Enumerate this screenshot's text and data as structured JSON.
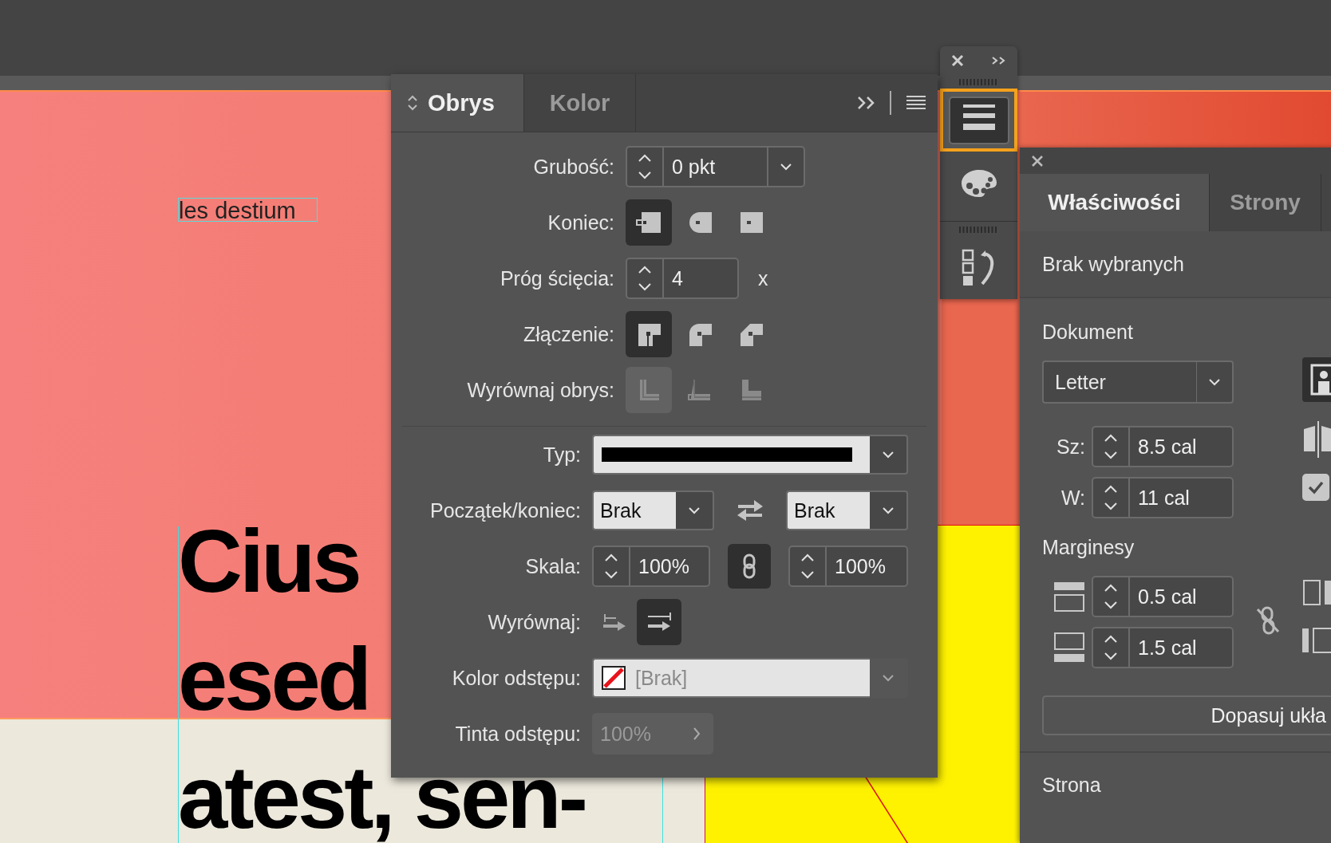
{
  "canvas": {
    "label_text": "les destium",
    "headline_lines": [
      "Cius",
      "esed",
      "atest, sen-"
    ]
  },
  "toolbar": {
    "buttons": [
      {
        "selected": true
      },
      {
        "selected": false
      },
      {
        "selected": false
      }
    ]
  },
  "stroke_panel": {
    "tabs": [
      {
        "label": "Obrys",
        "selected": true
      },
      {
        "label": "Kolor",
        "selected": false
      }
    ],
    "weight": {
      "label": "Grubość:",
      "value": "0 pkt"
    },
    "cap": {
      "label": "Koniec:",
      "options": [
        {
          "selected": true
        },
        {
          "selected": false
        },
        {
          "selected": false
        }
      ]
    },
    "miter": {
      "label": "Próg ścięcia:",
      "value": "4",
      "suffix": "x"
    },
    "join": {
      "label": "Złączenie:",
      "options": [
        {
          "selected": true
        },
        {
          "selected": false
        },
        {
          "selected": false
        }
      ]
    },
    "align_stroke": {
      "label": "Wyrównaj obrys:",
      "disabled": true,
      "options": [
        {
          "selected": true
        },
        {
          "selected": false
        },
        {
          "selected": false
        }
      ]
    },
    "type": {
      "label": "Typ:"
    },
    "start_end": {
      "label": "Początek/koniec:",
      "start": "Brak",
      "end": "Brak"
    },
    "scale": {
      "label": "Skala:",
      "start": "100%",
      "end": "100%",
      "linked": true
    },
    "align": {
      "label": "Wyrównaj:",
      "options": [
        {
          "selected": false
        },
        {
          "selected": true
        }
      ]
    },
    "gap_color": {
      "label": "Kolor odstępu:",
      "value": "[Brak]",
      "disabled": true
    },
    "gap_tint": {
      "label": "Tinta odstępu:",
      "value": "100%",
      "disabled": true
    }
  },
  "properties_panel": {
    "tabs": [
      {
        "label": "Właściwości",
        "selected": true
      },
      {
        "label": "Strony",
        "selected": false
      }
    ],
    "selection_status": "Brak wybranych",
    "document": {
      "heading": "Dokument",
      "preset": "Letter",
      "width_label": "Sz:",
      "width": "8.5 cal",
      "height_label": "W:",
      "height": "11 cal",
      "facing_pages": true
    },
    "margins": {
      "heading": "Marginesy",
      "top": "0.5 cal",
      "bottom": "1.5 cal",
      "linked": false
    },
    "adjust_button": "Dopasuj ukła",
    "page_heading": "Strona"
  }
}
